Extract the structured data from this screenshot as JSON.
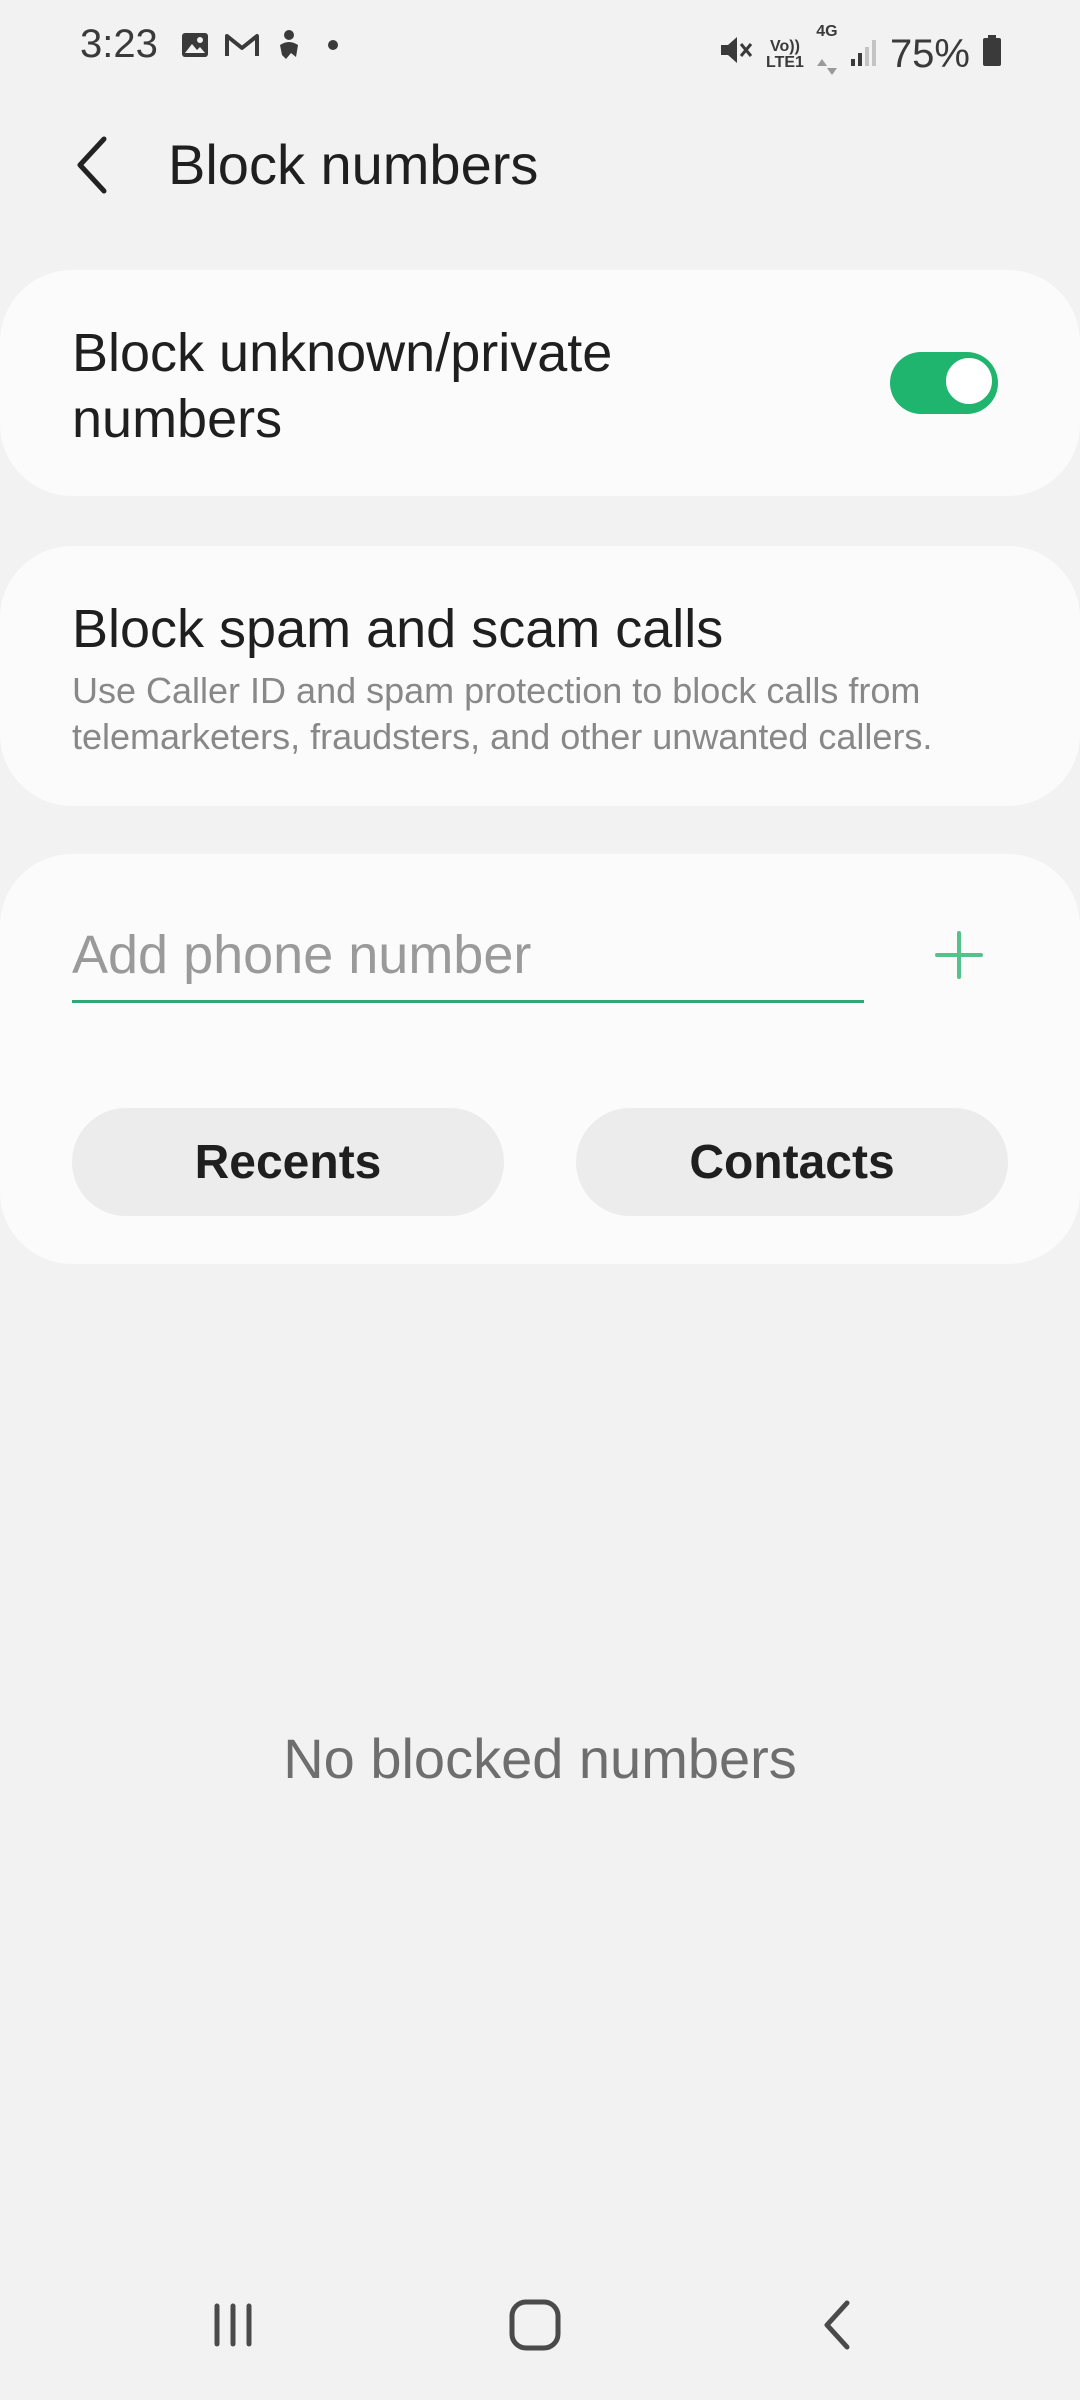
{
  "status_bar": {
    "time": "3:23",
    "battery": "75%",
    "volte_label_top": "Vo))",
    "volte_label_bottom": "LTE1",
    "network_label": "4G",
    "icons": [
      "gallery-icon",
      "gmail-icon",
      "accessibility-icon",
      "dot-icon",
      "mute-icon",
      "signal-icon",
      "battery-icon"
    ]
  },
  "header": {
    "title": "Block numbers",
    "back_icon": "chevron-left-icon"
  },
  "block_unknown": {
    "label": "Block unknown/private numbers",
    "enabled": true,
    "accent_color": "#1fb56e"
  },
  "block_spam": {
    "title": "Block spam and scam calls",
    "description": "Use Caller ID and spam protection to block calls from telemarketers, fraudsters, and other unwanted callers."
  },
  "add_number": {
    "placeholder": "Add phone number",
    "value": "",
    "add_icon": "plus-icon",
    "recents_label": "Recents",
    "contacts_label": "Contacts"
  },
  "empty_state": {
    "text": "No blocked numbers"
  },
  "nav_bar": {
    "icons": [
      "recent-apps-icon",
      "home-icon",
      "back-icon"
    ]
  }
}
